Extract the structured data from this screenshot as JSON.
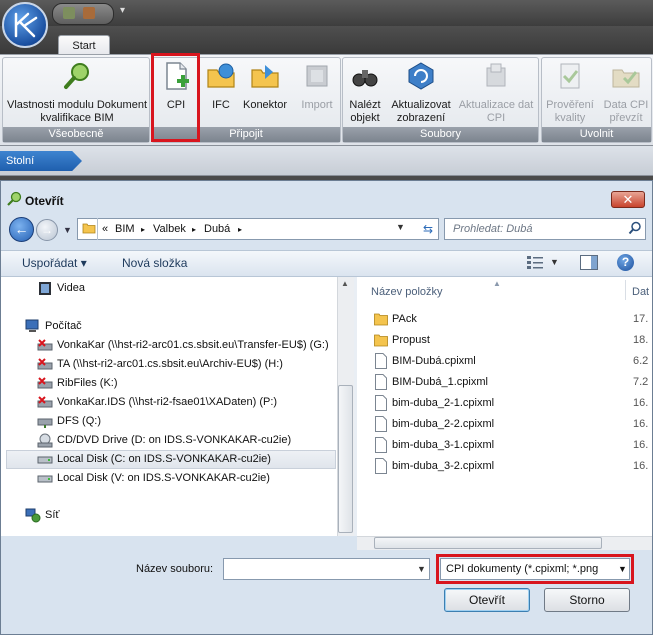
{
  "ribbon": {
    "tab": "Start",
    "groups": [
      {
        "label": "Všeobecně"
      },
      {
        "label": "Připojit"
      },
      {
        "label": "Soubory"
      },
      {
        "label": "Uvolnit"
      }
    ],
    "buttons": {
      "module_props": "Vlastnosti modulu Dokument kvalifikace BIM",
      "cpi": "CPI",
      "ifc": "IFC",
      "connector": "Konektor",
      "import": "Import",
      "find_object": "Nalézt objekt",
      "update_view": "Aktualizovat zobrazení",
      "update_cpi": "Aktualizace dat CPI",
      "check_quality": "Prověření kvality",
      "transfer_cpi": "Data CPI převzít"
    }
  },
  "navigation": {
    "breadcrumb": "Stolní počítač"
  },
  "dialog": {
    "title": "Otevřít",
    "close_label": "✕",
    "address": {
      "prefix": "«",
      "parts": [
        "BIM",
        "Valbek",
        "Dubá"
      ],
      "separator": "▸"
    },
    "search_placeholder": "Prohledat: Dubá",
    "toolbar": {
      "organize": "Uspořádat ▾",
      "new_folder": "Nová složka"
    },
    "tree": [
      {
        "label": "Videa",
        "icon": "video-folder-icon"
      },
      {
        "label": "Počítač",
        "icon": "computer-icon"
      },
      {
        "label": "VonkaKar (\\\\hst-ri2-arc01.cs.sbsit.eu\\Transfer-EU$) (G:)",
        "icon": "disconnected-drive-icon"
      },
      {
        "label": "TA (\\\\hst-ri2-arc01.cs.sbsit.eu\\Archiv-EU$) (H:)",
        "icon": "disconnected-drive-icon"
      },
      {
        "label": "RibFiles (K:)",
        "icon": "disconnected-drive-icon"
      },
      {
        "label": "VonkaKar.IDS (\\\\hst-ri2-fsae01\\XADaten) (P:)",
        "icon": "disconnected-drive-icon"
      },
      {
        "label": "DFS (Q:)",
        "icon": "network-drive-icon"
      },
      {
        "label": "CD/DVD Drive (D: on IDS.S-VONKAKAR-cu2ie)",
        "icon": "dvd-drive-icon"
      },
      {
        "label": "Local Disk (C: on IDS.S-VONKAKAR-cu2ie)",
        "icon": "disk-icon"
      },
      {
        "label": "Local Disk (V: on IDS.S-VONKAKAR-cu2ie)",
        "icon": "disk-icon"
      },
      {
        "label": "Síť",
        "icon": "network-icon"
      }
    ],
    "columns": {
      "name": "Název položky",
      "date": "Dat"
    },
    "files": [
      {
        "name": "PAck",
        "type": "folder",
        "date": "17."
      },
      {
        "name": "Propust",
        "type": "folder",
        "date": "18."
      },
      {
        "name": "BIM-Dubá.cpixml",
        "type": "file",
        "date": "6.2"
      },
      {
        "name": "BIM-Dubá_1.cpixml",
        "type": "file",
        "date": "7.2"
      },
      {
        "name": "bim-duba_2-1.cpixml",
        "type": "file",
        "date": "16."
      },
      {
        "name": "bim-duba_2-2.cpixml",
        "type": "file",
        "date": "16."
      },
      {
        "name": "bim-duba_3-1.cpixml",
        "type": "file",
        "date": "16."
      },
      {
        "name": "bim-duba_3-2.cpixml",
        "type": "file",
        "date": "16."
      }
    ],
    "filename_label": "Název souboru:",
    "filename_value": "",
    "filetype_value": "CPI dokumenty  (*.cpixml; *.png",
    "open_button": "Otevřít",
    "cancel_button": "Storno"
  },
  "colors": {
    "highlight": "#d8151e",
    "ribbon_group_label": "#7c848e",
    "breadcrumb": "#1f5fae"
  }
}
